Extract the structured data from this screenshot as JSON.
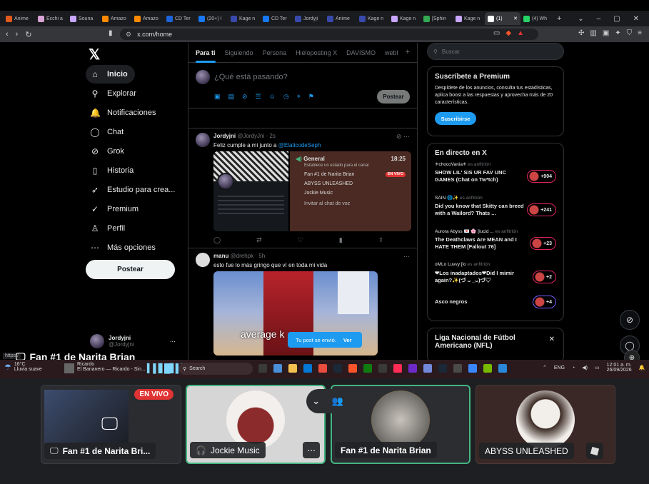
{
  "browser": {
    "tabs": [
      {
        "label": "Anime",
        "color": "#e05a1e"
      },
      {
        "label": "Ecchi a",
        "color": "#d9a3d6"
      },
      {
        "label": "Souna",
        "color": "#c9a6ff"
      },
      {
        "label": "Amazo",
        "color": "#ff8a00"
      },
      {
        "label": "Amazo",
        "color": "#ff8a00"
      },
      {
        "label": "CD Ter",
        "color": "#1c64d8"
      },
      {
        "label": "(20+) I",
        "color": "#1877f2"
      },
      {
        "label": "Kage n",
        "color": "#3949ab"
      },
      {
        "label": "CD Ter",
        "color": "#1877f2"
      },
      {
        "label": "Jordyji",
        "color": "#3949ab"
      },
      {
        "label": "Anime",
        "color": "#3949ab"
      },
      {
        "label": "Kage n",
        "color": "#3949ab"
      },
      {
        "label": "Kage n",
        "color": "#c9a6ff"
      },
      {
        "label": "[Sphin",
        "color": "#34a853"
      },
      {
        "label": "Kage n",
        "color": "#c9a6ff"
      },
      {
        "label": "(1)",
        "color": "#ffffff",
        "active": true
      },
      {
        "label": "(4) Wh",
        "color": "#25d366"
      }
    ],
    "url": "x.com/home"
  },
  "x": {
    "nav": [
      {
        "label": "Inicio",
        "icon": "home-icon",
        "glyph": "⌂",
        "active": true
      },
      {
        "label": "Explorar",
        "icon": "search-icon",
        "glyph": "⚲"
      },
      {
        "label": "Notificaciones",
        "icon": "bell-icon",
        "glyph": "🔔"
      },
      {
        "label": "Chat",
        "icon": "chat-icon",
        "glyph": "◯"
      },
      {
        "label": "Grok",
        "icon": "grok-icon",
        "glyph": "⊘"
      },
      {
        "label": "Historia",
        "icon": "bookmark-icon",
        "glyph": "▯"
      },
      {
        "label": "Estudio para crea...",
        "icon": "rocket-icon",
        "glyph": "➶"
      },
      {
        "label": "Premium",
        "icon": "premium-icon",
        "glyph": "✓"
      },
      {
        "label": "Perfil",
        "icon": "profile-icon",
        "glyph": "♙"
      },
      {
        "label": "Más opciones",
        "icon": "more-icon",
        "glyph": "⋯"
      }
    ],
    "post_button": "Postear",
    "account": {
      "name": "Jordyjni",
      "handle": "@Jordyjni"
    },
    "feed_tabs": [
      "Para ti",
      "Siguiendo",
      "Persona",
      "Hieloposting X",
      "DAVISMO",
      "webl"
    ],
    "compose_placeholder": "¿Qué está pasando?",
    "compose_post": "Postear",
    "tweets": [
      {
        "name": "Jordyjni",
        "handle": "@JordyJni",
        "time": "· 2s",
        "text": "Feliz cumple a mi junto a ",
        "mention": "@ElaticodeSeph"
      },
      {
        "name": "manu",
        "handle": "@drehpk",
        "time": "· 5h",
        "text": "esto fue lo más gringo que ví en toda mi vida"
      }
    ],
    "discord_embed": {
      "channel": "General",
      "time": "18:25",
      "status": "Establece un estado para el canal",
      "members": [
        "Fan #1 de Narita Brian",
        "ABYSS UNLEASHED",
        "Jockie Music"
      ],
      "live": "EN VIVO",
      "invite": "Invitar al chat de voz"
    },
    "meme_caption": "average k",
    "search_placeholder": "Buscar",
    "premium": {
      "title": "Suscríbete a Premium",
      "text": "Despídete de los anuncios, consulta tus estadísticas, aplica boost a las respuestas y aprovecha más de 20 características.",
      "button": "Suscribirse"
    },
    "live_title": "En directo en X",
    "live_items": [
      {
        "host": "✳chocoVania✳",
        "tag": "es anfitrión",
        "title": "SHOW LIL' SIS UR FAV UNC GAMES (Chat on Tw*tch)",
        "count": "+904"
      },
      {
        "host": "SAIN 🌐✨",
        "tag": "es anfitrión",
        "title": "Did you know that Skitty can breed with a Wailord? Thats ...",
        "count": "+241"
      },
      {
        "host": "Aurora Abyss 💌 🌸 [lucid ...",
        "tag": "es anfitrión",
        "title": "The Deathclaws Are MEAN and I HATE THEM [Fallout 76]",
        "count": "+23"
      },
      {
        "host": "oMLo Luvvy [lo",
        "tag": "es anfitrión",
        "title": "❤Los inadaptados❤Did I mimir again?✨(づ ᴗ _ᴗ)づ♡",
        "count": "+2"
      },
      {
        "host": "",
        "tag": "",
        "title": "Asco negros",
        "count": "+4"
      }
    ],
    "nfl_card": "Liga Nacional de Fútbol Americano (NFL)",
    "toast": {
      "text": "Tu post se envió.",
      "action": "Ver"
    }
  },
  "overlay_title": "Fan #1 de Narita Brian",
  "status_url": "https:/",
  "taskbar": {
    "weather_temp": "16°C",
    "weather_desc": "Lluvia suave",
    "media_title": "Ricardo",
    "media_sub": "El Bananero — Ricardo - Sin...",
    "search": "Search",
    "lang": "ENG",
    "time": "12:01 a. m.",
    "date": "26/09/2026",
    "icon_colors": [
      "#3a3a3a",
      "#4a90d9",
      "#f2c14e",
      "#0078d4",
      "#e84d3d",
      "#1b2838",
      "#fb542b",
      "#107c10",
      "#3a3a3a",
      "#ff2d55",
      "#6e2ac9",
      "#7289da",
      "#1b2838",
      "#4a4a4a",
      "#3a86ff",
      "#76b900",
      "#2b88d8"
    ]
  },
  "call": {
    "tiles": [
      {
        "name": "Fan #1 de Narita Bri...",
        "badge": "EN VIVO",
        "type": "stream"
      },
      {
        "name": "Jockie Music",
        "type": "bot"
      },
      {
        "name": "Fan #1 de Narita Brian",
        "type": "user"
      },
      {
        "name": "ABYSS UNLEASHED",
        "type": "user2"
      }
    ]
  }
}
